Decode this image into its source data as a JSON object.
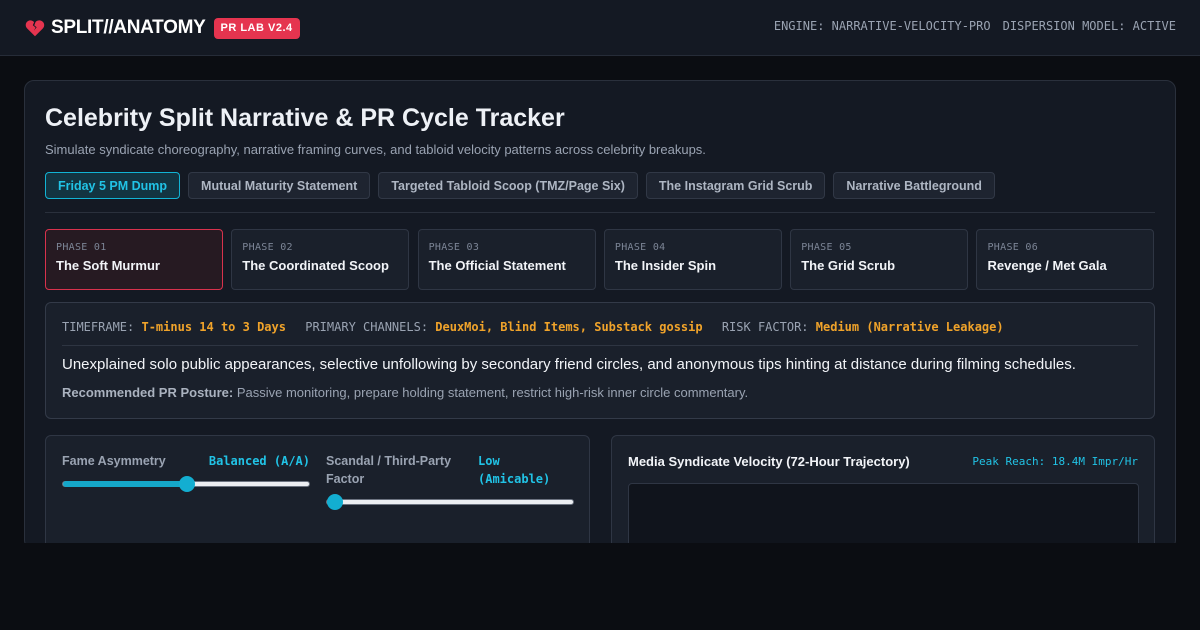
{
  "app": {
    "name": "SPLIT//ANATOMY",
    "badge": "PR LAB V2.4",
    "icon": "broken-heart-icon",
    "engine": "ENGINE: NARRATIVE-VELOCITY-PRO",
    "dispersion": "DISPERSION MODEL: ACTIVE"
  },
  "colors": {
    "accent_cyan": "#21c3e6",
    "accent_red": "#e5344f",
    "highlight_amber": "#f0a32a",
    "background": "#0b0d12",
    "panel": "#141923"
  },
  "main": {
    "title": "Celebrity Split Narrative & PR Cycle Tracker",
    "subtitle": "Simulate syndicate choreography, narrative framing curves, and tabloid velocity patterns across celebrity breakups."
  },
  "tabs": [
    {
      "label": "Friday 5 PM Dump",
      "active": true
    },
    {
      "label": "Mutual Maturity Statement",
      "active": false
    },
    {
      "label": "Targeted Tabloid Scoop (TMZ/Page Six)",
      "active": false
    },
    {
      "label": "The Instagram Grid Scrub",
      "active": false
    },
    {
      "label": "Narrative Battleground",
      "active": false
    }
  ],
  "phases": [
    {
      "num": "PHASE 01",
      "name": "The Soft Murmur",
      "active": true
    },
    {
      "num": "PHASE 02",
      "name": "The Coordinated Scoop",
      "active": false
    },
    {
      "num": "PHASE 03",
      "name": "The Official Statement",
      "active": false
    },
    {
      "num": "PHASE 04",
      "name": "The Insider Spin",
      "active": false
    },
    {
      "num": "PHASE 05",
      "name": "The Grid Scrub",
      "active": false
    },
    {
      "num": "PHASE 06",
      "name": "Revenge / Met Gala",
      "active": false
    }
  ],
  "detail": {
    "timeframe_label": "TIMEFRAME:",
    "timeframe_value": "T-minus 14 to 3 Days",
    "channels_label": "PRIMARY CHANNELS:",
    "channels_value": "DeuxMoi, Blind Items, Substack gossip",
    "risk_label": "RISK FACTOR:",
    "risk_value": "Medium (Narrative Leakage)",
    "description": "Unexplained solo public appearances, selective unfollowing by secondary friend circles, and anonymous tips hinting at distance during filming schedules.",
    "posture_label": "Recommended PR Posture:",
    "posture_text": "Passive monitoring, prepare holding statement, restrict high-risk inner circle commentary."
  },
  "sliders": [
    {
      "label": "Fame Asymmetry",
      "value_text": "Balanced (A/A)",
      "level": 0.5
    },
    {
      "label": "Scandal / Third-Party Factor",
      "value_text": "Low (Amicable)",
      "level": 0.0
    }
  ],
  "velocity": {
    "title": "Media Syndicate Velocity (72-Hour Trajectory)",
    "peak": "Peak Reach: 18.4M Impr/Hr"
  }
}
